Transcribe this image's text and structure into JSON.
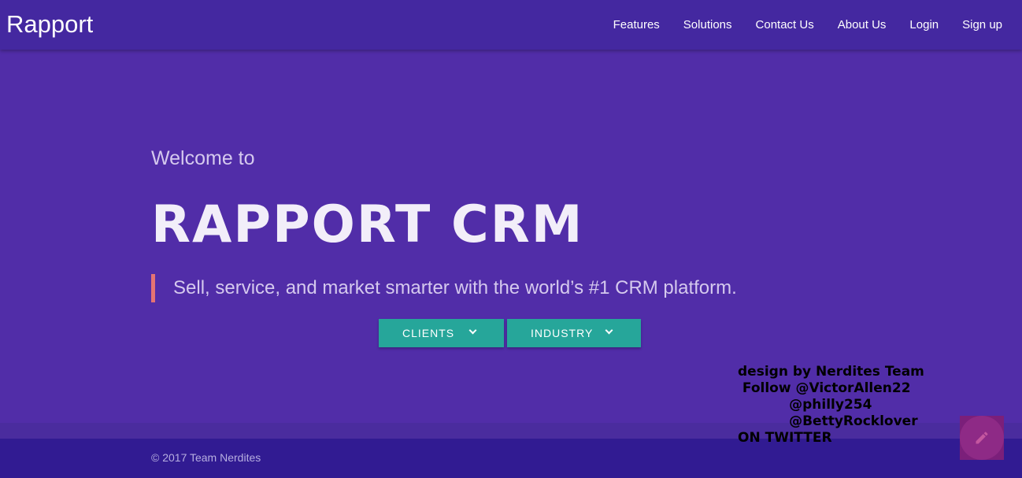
{
  "navbar": {
    "brand": "Rapport",
    "links": [
      "Features",
      "Solutions",
      "Contact Us",
      "About Us",
      "Login",
      "Sign up"
    ]
  },
  "hero": {
    "welcome": "Welcome to",
    "title": "RAPPORT CRM",
    "tagline": "Sell, service, and market smarter with the world’s #1 CRM platform.",
    "buttons": {
      "clients": "CLIENTS",
      "industry": "INDUSTRY"
    }
  },
  "credits": {
    "line1": "design by Nerdites Team",
    "line2": " Follow @VictorAllen22",
    "line3": "           @philly254",
    "line4": "           @BettyRocklover",
    "line5": "ON TWITTER"
  },
  "footer": {
    "copyright": "© 2017 Team Nerdites"
  },
  "icons": {
    "fab": "pencil-icon",
    "dropdown": "chevron-down-icon"
  },
  "colors": {
    "nav_bg": "#4428a0",
    "hero_bg": "#512da8",
    "button_bg": "#26a69a",
    "quote_accent": "#e57373",
    "footer_bg": "#311b92",
    "fab_bg": "#8e2a86"
  }
}
